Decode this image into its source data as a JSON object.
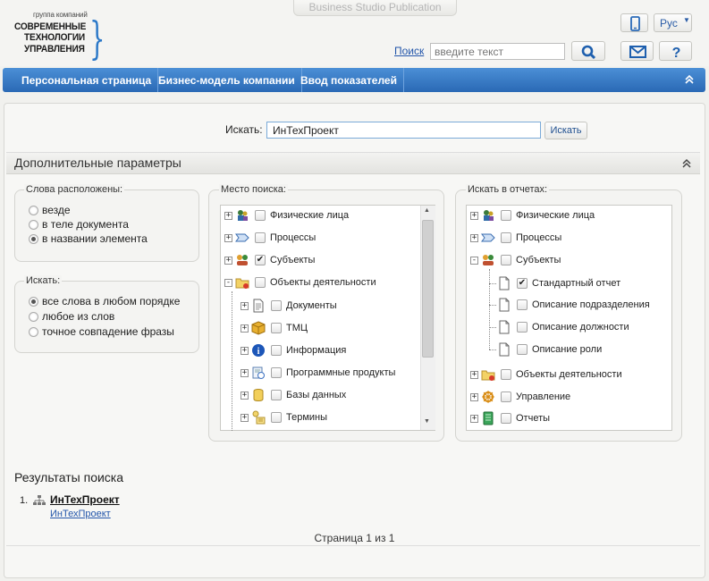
{
  "header": {
    "pub_tab": "Business Studio Publication",
    "logo_small": "группа компаний",
    "logo_lines": [
      "СОВРЕМЕННЫЕ",
      "ТЕХНОЛОГИИ",
      "УПРАВЛЕНИЯ"
    ],
    "lang": "Рус",
    "search_link": "Поиск",
    "search_placeholder": "введите текст"
  },
  "nav": {
    "items": [
      "Персональная страница",
      "Бизнес-модель компании",
      "Ввод показателей"
    ]
  },
  "search": {
    "label": "Искать:",
    "value": "ИнТехПроект",
    "button": "Искать"
  },
  "advanced": {
    "title": "Дополнительные параметры",
    "words_legend": "Слова расположены:",
    "words_options": [
      "везде",
      "в теле документа",
      "в названии элемента"
    ],
    "words_selected": 2,
    "find_legend": "Искать:",
    "find_options": [
      "все слова в любом порядке",
      "любое из слов",
      "точное совпадение фразы"
    ],
    "find_selected": 0,
    "place_legend": "Место поиска:",
    "place_items": [
      {
        "label": "Физические лица",
        "checked": false,
        "icon": "people-icon"
      },
      {
        "label": "Процессы",
        "checked": false,
        "icon": "process-arrow-icon"
      },
      {
        "label": "Субъекты",
        "checked": true,
        "icon": "subjects-icon"
      },
      {
        "label": "Объекты деятельности",
        "checked": false,
        "icon": "folder-icon"
      },
      {
        "label": "Документы",
        "checked": false,
        "icon": "document-icon"
      },
      {
        "label": "ТМЦ",
        "checked": false,
        "icon": "box-icon"
      },
      {
        "label": "Информация",
        "checked": false,
        "icon": "info-icon"
      },
      {
        "label": "Программные продукты",
        "checked": false,
        "icon": "software-icon"
      },
      {
        "label": "Базы данных",
        "checked": false,
        "icon": "database-icon"
      },
      {
        "label": "Термины",
        "checked": false,
        "icon": "terms-icon"
      }
    ],
    "reports_legend": "Искать в отчетах:",
    "report_items": [
      {
        "label": "Физические лица",
        "checked": false,
        "icon": "people-icon"
      },
      {
        "label": "Процессы",
        "checked": false,
        "icon": "process-arrow-icon"
      },
      {
        "label": "Субъекты",
        "checked": false,
        "icon": "subjects-icon"
      },
      {
        "label": "Стандартный отчет",
        "checked": true,
        "icon": "page-icon"
      },
      {
        "label": "Описание подразделения",
        "checked": false,
        "icon": "page-icon"
      },
      {
        "label": "Описание должности",
        "checked": false,
        "icon": "page-icon"
      },
      {
        "label": "Описание роли",
        "checked": false,
        "icon": "page-icon"
      },
      {
        "label": "Объекты деятельности",
        "checked": false,
        "icon": "folder-icon"
      },
      {
        "label": "Управление",
        "checked": false,
        "icon": "wheel-icon"
      },
      {
        "label": "Отчеты",
        "checked": false,
        "icon": "reports-icon"
      }
    ]
  },
  "results": {
    "title": "Результаты поиска",
    "items": [
      {
        "num": "1.",
        "title": "ИнТехПроект",
        "link": "ИнТехПроект"
      }
    ],
    "pager": "Страница 1 из 1"
  },
  "colors": {
    "nav_blue": "#2a69b5",
    "link_blue": "#2255aa",
    "brace_blue": "#2b78c8"
  }
}
